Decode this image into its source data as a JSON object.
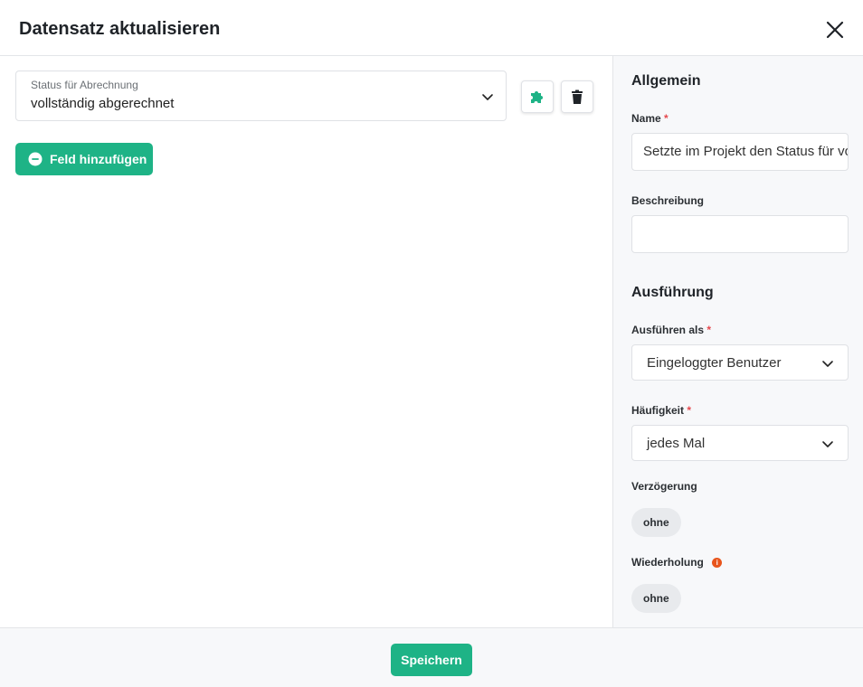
{
  "dialog": {
    "title": "Datensatz aktualisieren",
    "close_icon": "close-icon"
  },
  "main": {
    "field_select": {
      "label": "Status für Abrechnung",
      "value": "vollständig abgerechnet"
    },
    "buttons": {
      "plugin_icon": "puzzle-icon",
      "delete_icon": "trash-icon",
      "add_field_label": "Feld hinzufügen"
    }
  },
  "sidebar": {
    "general": {
      "title": "Allgemein",
      "name_label": "Name",
      "name_value": "Setzte im Projekt den Status für vo",
      "description_label": "Beschreibung",
      "description_value": ""
    },
    "execution": {
      "title": "Ausführung",
      "run_as_label": "Ausführen als",
      "run_as_value": "Eingeloggter Benutzer",
      "frequency_label": "Häufigkeit",
      "frequency_value": "jedes Mal",
      "delay_label": "Verzögerung",
      "delay_value": "ohne",
      "repeat_label": "Wiederholung",
      "repeat_value": "ohne"
    },
    "required_mark": "*"
  },
  "footer": {
    "save_label": "Speichern"
  },
  "colors": {
    "accent": "#1eb386",
    "required": "#e5484d",
    "info": "#e8551c"
  }
}
